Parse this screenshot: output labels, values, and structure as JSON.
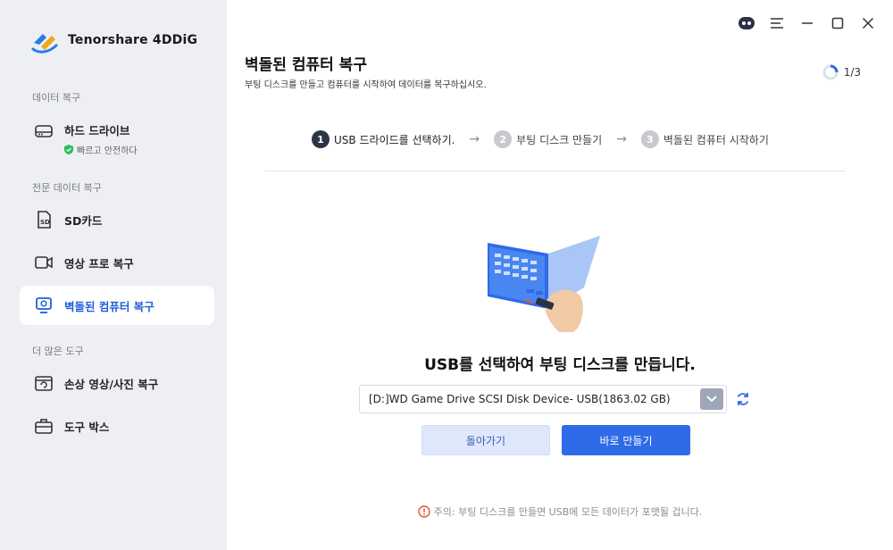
{
  "app": {
    "name": "Tenorshare 4DDiG"
  },
  "sidebar": {
    "sections": [
      {
        "label": "데이터 복구"
      },
      {
        "label": "전문 데이터 복구"
      },
      {
        "label": "더 많은 도구"
      }
    ],
    "items": [
      {
        "label": "하드 드라이브",
        "sub": "빠르고 안전하다",
        "icon": "hard-drive-icon"
      },
      {
        "label": "SD카드",
        "icon": "sd-card-icon"
      },
      {
        "label": "영상 프로 복구",
        "icon": "video-camera-icon"
      },
      {
        "label": "벽돌된 컴퓨터 복구",
        "icon": "computer-icon",
        "active": true
      },
      {
        "label": "손상 영상/사진 복구",
        "icon": "image-repair-icon"
      },
      {
        "label": "도구 박스",
        "icon": "toolbox-icon"
      }
    ]
  },
  "main": {
    "title": "벽돌된 컴퓨터 복구",
    "subtitle": "부팅 디스크를 만들고 컴퓨터를 시작하여 데이터를 복구하십시오.",
    "progress": "1/3",
    "steps": [
      {
        "num": "1",
        "label": "USB 드라이드를 선택하기.",
        "active": true
      },
      {
        "num": "2",
        "label": "부팅 디스크 만들기"
      },
      {
        "num": "3",
        "label": "벽돌된 컴퓨터 시작하기"
      }
    ],
    "step_arrow": "→",
    "heading": "USB를 선택하여 부팅 디스크를 만듭니다.",
    "usb_select": {
      "value": "[D:]WD Game Drive SCSI Disk Device- USB(1863.02 GB)"
    },
    "buttons": {
      "back": "돌아가기",
      "make": "바로 만들기"
    },
    "note": "주의: 부팅 디스크를 만들면 USB에 모든 데이터가 포맷될 겁니다."
  },
  "colors": {
    "accent": "#2f6ae8",
    "sidebar_bg": "#eeeff2",
    "active_text": "#1f5ed8",
    "warning": "#e8552f"
  }
}
